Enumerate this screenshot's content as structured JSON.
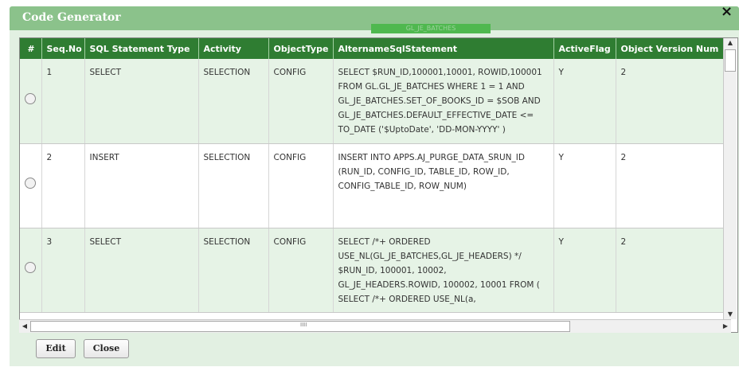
{
  "dialog": {
    "title": "Code Generator",
    "close_glyph": "×",
    "background_text": "GL_JE_BATCHES"
  },
  "grid": {
    "columns": [
      "#",
      "Seq.No",
      "SQL Statement Type",
      "Activity",
      "ObjectType",
      "AlternameSqlStatement",
      "ActiveFlag",
      "Object Version Num"
    ],
    "rows": [
      {
        "seq": "1",
        "type": "SELECT",
        "activity": "SELECTION",
        "object_type": "CONFIG",
        "statement": "SELECT $RUN_ID,100001,10001, ROWID,100001 FROM GL.GL_JE_BATCHES WHERE  1 = 1   AND GL_JE_BATCHES.SET_OF_BOOKS_ID = $SOB  AND GL_JE_BATCHES.DEFAULT_EFFECTIVE_DATE <= TO_DATE ('$UptoDate', 'DD-MON-YYYY' )",
        "active_flag": "Y",
        "version": "2"
      },
      {
        "seq": "2",
        "type": "INSERT",
        "activity": "SELECTION",
        "object_type": "CONFIG",
        "statement": "INSERT INTO APPS.AJ_PURGE_DATA_SRUN_ID (RUN_ID, CONFIG_ID, TABLE_ID, ROW_ID, CONFIG_TABLE_ID, ROW_NUM)",
        "active_flag": "Y",
        "version": "2"
      },
      {
        "seq": "3",
        "type": "SELECT",
        "activity": "SELECTION",
        "object_type": "CONFIG",
        "statement": "SELECT  /*+ ORDERED USE_NL(GL_JE_BATCHES,GL_JE_HEADERS) */ $RUN_ID, 100001, 10002, GL_JE_HEADERS.ROWID, 100002, 10001 FROM ( SELECT /*+ ORDERED USE_NL(a,",
        "active_flag": "Y",
        "version": "2"
      }
    ]
  },
  "scrollbars": {
    "up_arrow": "▲",
    "down_arrow": "▼",
    "left_arrow": "◀",
    "right_arrow": "▶",
    "grip": "IIII"
  },
  "buttons": {
    "edit": "Edit",
    "close": "Close"
  },
  "colors": {
    "title_bar": "#8bc28b",
    "header": "#2f7d32",
    "row_alt": "#e6f3e6",
    "dialog_body": "#e2f0e2"
  }
}
